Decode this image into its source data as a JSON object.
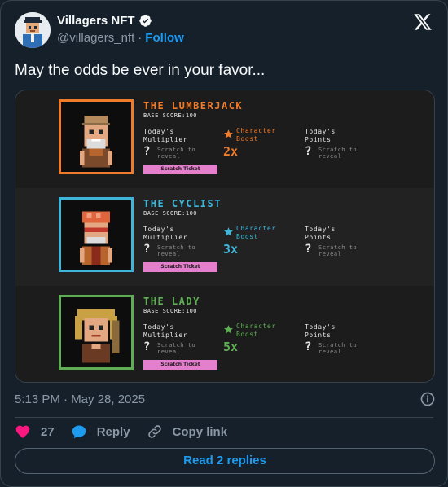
{
  "author": {
    "name": "Villagers NFT",
    "handle": "@villagers_nft",
    "separator": "·",
    "follow_label": "Follow"
  },
  "tweet": {
    "text": "May the odds be ever in your favor...",
    "timestamp": "5:13 PM · May 28, 2025"
  },
  "media": {
    "characters": [
      {
        "name": "THE LUMBERJACK",
        "accent": "#f07b29",
        "base_score": "BASE SCORE:100",
        "multiplier_label": "Today's Multiplier",
        "scratch_note": "Scratch to reveal",
        "boost_label": "Character Boost",
        "boost_value": "2x",
        "points_label": "Today's Points",
        "points_scratch_note": "Scratch to reveal",
        "ticket_label": "Scratch Ticket"
      },
      {
        "name": "THE CYCLIST",
        "accent": "#3fb6d9",
        "base_score": "BASE SCORE:100",
        "multiplier_label": "Today's Multiplier",
        "scratch_note": "Scratch to reveal",
        "boost_label": "Character Boost",
        "boost_value": "3x",
        "points_label": "Today's Points",
        "points_scratch_note": "Scratch to reveal",
        "ticket_label": "Scratch Ticket"
      },
      {
        "name": "THE LADY",
        "accent": "#5fad55",
        "base_score": "BASE SCORE:100",
        "multiplier_label": "Today's Multiplier",
        "scratch_note": "Scratch to reveal",
        "boost_label": "Character Boost",
        "boost_value": "5x",
        "points_label": "Today's Points",
        "points_scratch_note": "Scratch to reveal",
        "ticket_label": "Scratch Ticket"
      }
    ]
  },
  "actions": {
    "like_count": "27",
    "reply_label": "Reply",
    "copy_link_label": "Copy link",
    "read_replies_label": "Read 2 replies"
  },
  "colors": {
    "background": "#15202b",
    "link_blue": "#1d9bf0",
    "like_pink": "#f91880",
    "muted": "#8b98a5",
    "ticket_pink": "#e37fcc"
  },
  "icons": [
    "verified-badge-icon",
    "x-logo-icon",
    "info-icon",
    "heart-icon",
    "reply-bubble-icon",
    "link-icon",
    "star-icon",
    "question-mark-icon"
  ]
}
